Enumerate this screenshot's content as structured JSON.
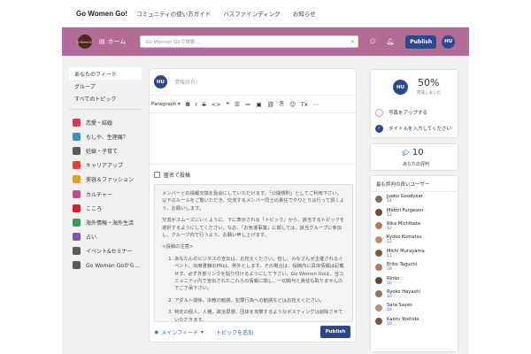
{
  "topbar": {
    "brand": "Go Women Go!",
    "links": [
      "コミュニティの使い方ガイド",
      "パスファインディング",
      "お知らせ"
    ]
  },
  "header": {
    "home_label": "ホーム",
    "search_placeholder": "Go Women Goで検索...",
    "publish_label": "Publish",
    "avatar_initials": "HU",
    "logo_text": "Go Women Go!"
  },
  "leftnav": {
    "items": [
      "あなたのフィード",
      "グループ",
      "すべてのトピック"
    ],
    "categories": [
      {
        "label": "恋愛・結婚",
        "icon": "heart-chat-icon",
        "color": "#c94060"
      },
      {
        "label": "もしや、生理痛？",
        "icon": "globe-icon",
        "color": "#4a8ab5"
      },
      {
        "label": "妊娠・子育て",
        "icon": "baby-icon",
        "color": "#5a5a5a"
      },
      {
        "label": "キャリアアップ",
        "icon": "person-chart-icon",
        "color": "#d9463a"
      },
      {
        "label": "美容＆ファッション",
        "icon": "lipstick-icon",
        "color": "#e0a030"
      },
      {
        "label": "カルチャー",
        "icon": "palette-icon",
        "color": "#c0508a"
      },
      {
        "label": "こころ",
        "icon": "heart-icon",
        "color": "#d0202a"
      },
      {
        "label": "海外情報・海外生活",
        "icon": "world-icon",
        "color": "#3d9a5a"
      },
      {
        "label": "占い",
        "icon": "crystal-ball-icon",
        "color": "#7a58b0"
      },
      {
        "label": "イベント&セミナー",
        "icon": "calendar-icon",
        "color": "#5a5a5a"
      },
      {
        "label": "Go Women Goから...",
        "icon": "laptop-icon",
        "color": "#5a5a5a"
      }
    ]
  },
  "composer": {
    "avatar_initials": "HU",
    "placeholder": "情報共有！",
    "paragraph_label": "Paragraph",
    "anonymous_label": "匿名で投稿",
    "rules": {
      "intro": "メンバーとの情報交換を励会にしていただけます。「公開規則」としてご利用下さい。以下のルールをご覧いただき、交流するメンバー同士の責任でやりとりは行って頂くよう、お願いします。",
      "topic_note": "交流がスムーズにいくように、下に表示される「トピック」から、該当するトピックを選択するようにしてください。なお、「お気遣事業」に関しては、該当グループに参加し、グループ内で行うよう、お願い申し上げます。",
      "heading": "<投稿の注意>",
      "list": [
        "あなたんのビジネスの宣伝は、お控えください。但し、みなさんが主催されるイベント、出席書籍のPRは、例外とします。その場合は、投稿内に具体情報は記載せず、必ず外部リンクを貼り付けるようにして下さい。Go Women Goは、当コミュニティ内で宣伝されたこれらの情報に関し、一切関与と責任も取りませんのでご了承下さい。",
        "アダルト関係、宗教の勧誘、犯罪行為への勧誘などはお控えください。",
        "特定の個人、人種、政治思想、団体を攻撃するようなポスティングは削除させていただきます。"
      ]
    },
    "menu_feed_label": "メインフィード",
    "add_topic_label": "トピックを追加",
    "publish_label": "Publish"
  },
  "progress": {
    "avatar_initials": "HU",
    "percent": "50%",
    "subtitle": "完成しました",
    "tasks": [
      {
        "label": "写真をアップする",
        "done": false
      },
      {
        "label": "タイトルを入力してください",
        "done": true
      }
    ]
  },
  "rating": {
    "value": "10",
    "label": "あなたの評判"
  },
  "top_users": {
    "title": "最も評判の良いユーザー",
    "users": [
      {
        "name": "Jueko Goodyear",
        "score": "14",
        "color": "#8a6a5a"
      },
      {
        "name": "Midori Furgason",
        "score": "12",
        "color": "#6a4a3a"
      },
      {
        "name": "Rika Michibata",
        "score": "12",
        "color": "#b07a60"
      },
      {
        "name": "Kyoko Komatsu",
        "score": "12",
        "color": "#c08a70"
      },
      {
        "name": "Michi Murayama",
        "score": "11",
        "color": "#7a5a4a"
      },
      {
        "name": "Eriko Taguchi",
        "score": "10",
        "color": "#a08070"
      },
      {
        "name": "Rinko",
        "score": "10",
        "color": "#5a4a3a"
      },
      {
        "name": "Ryoko Hayashi",
        "score": "10",
        "color": "#9a7060"
      },
      {
        "name": "Sara Sayes",
        "score": "10",
        "color": "#b09080"
      },
      {
        "name": "Kaoru Yoshida",
        "score": "10",
        "color": "#6a5a50"
      }
    ]
  },
  "colors": {
    "header_bg": "#b36b97",
    "accent": "#2c4a8a",
    "link": "#3b5fa8"
  }
}
